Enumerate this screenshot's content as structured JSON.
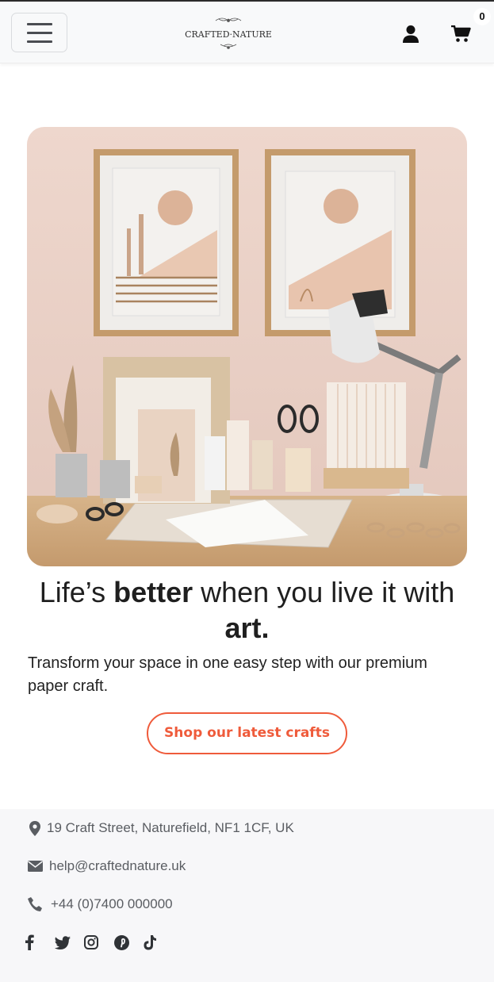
{
  "navbar": {
    "brand_name": "CRAFTED·NATURE",
    "cart_count": "0",
    "icons": [
      "menu-icon",
      "user-icon",
      "cart-icon"
    ]
  },
  "hero": {
    "image_description_icon": "hero-image",
    "headline_part1": "Life’s ",
    "headline_bold1": "better",
    "headline_part2": " when you live it with ",
    "headline_bold2": "art",
    "headline_part3": ".",
    "subtext": "Transform your space in one easy step with our premium paper craft.",
    "cta_label": "Shop our latest crafts"
  },
  "footer": {
    "address": "19 Craft Street, Naturefield, NF1 1CF, UK",
    "email": "help@craftednature.uk",
    "phone": "+44 (0)7400 000000",
    "social_icons": [
      "facebook-icon",
      "twitter-icon",
      "instagram-icon",
      "pinterest-icon",
      "tiktok-icon"
    ]
  },
  "colors": {
    "accent": "#ef5b3b",
    "navbar_bg": "#f8f9fa",
    "footer_bg": "#f7f7f9",
    "footer_text": "#5a5d62"
  }
}
